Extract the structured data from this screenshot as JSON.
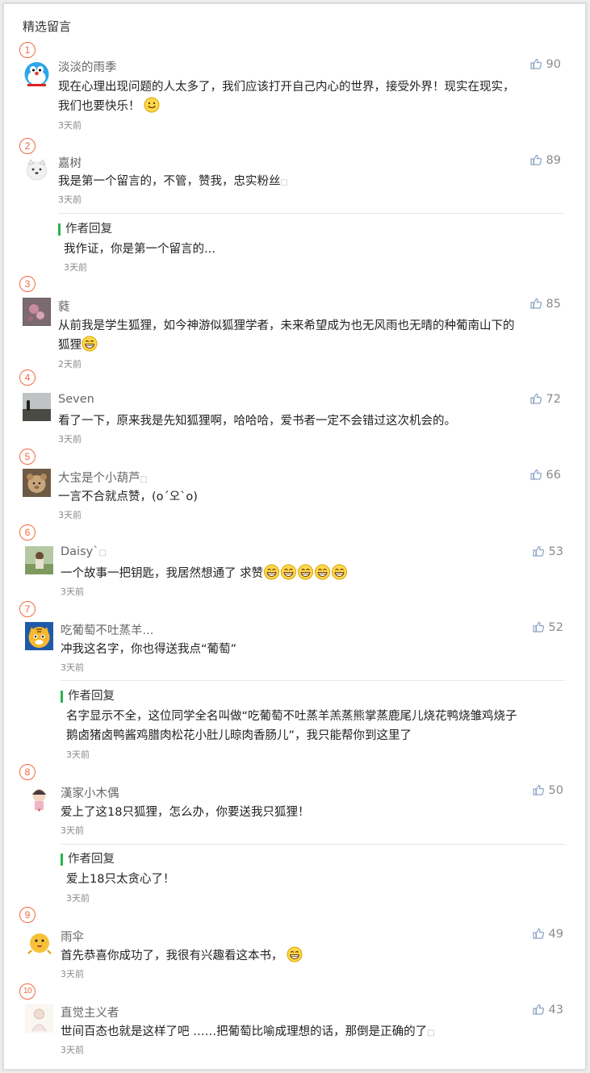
{
  "section_title": "精选留言",
  "reply_label": "作者回复",
  "comments": [
    {
      "num": "1",
      "nick": "淡淡的雨季",
      "likes": "90",
      "line1": "现在心理出现问题的人太多了，我们应该打开自己内心的世界，接受外界！现实在现实，",
      "line2": "我们也要快乐！",
      "time": "3天前",
      "avatar": "doraemon"
    },
    {
      "num": "2",
      "nick": "嘉树",
      "likes": "89",
      "line1": "我是第一个留言的，不管，赞我，忠实粉丝",
      "line2": "",
      "time": "3天前",
      "avatar": "white-dog",
      "reply": {
        "text": "我作证，你是第一个留言的...",
        "time": "3天前"
      }
    },
    {
      "num": "3",
      "nick": "蕤",
      "likes": "85",
      "line1": "从前我是学生狐狸，如今神游似狐狸学者，未来希望成为也无风雨也无晴的种葡南山下的",
      "line2": "狐狸",
      "time": "2天前",
      "avatar": "flower"
    },
    {
      "num": "4",
      "nick": "Seven",
      "likes": "72",
      "line1": "看了一下，原来我是先知狐狸啊，哈哈哈，爱书者一定不会错过这次机会的。",
      "line2": "",
      "time": "3天前",
      "avatar": "landscape"
    },
    {
      "num": "5",
      "nick": "大宝是个小葫芦",
      "likes": "66",
      "line1": "一言不合就点赞，(o´오`o)",
      "line2": "",
      "time": "3天前",
      "avatar": "bear"
    },
    {
      "num": "6",
      "nick": "Daisy`",
      "likes": "53",
      "line1": "一个故事一把钥匙，我居然想通了 求赞",
      "line2": "",
      "time": "3天前",
      "avatar": "girl"
    },
    {
      "num": "7",
      "nick": "吃葡萄不吐蒸羊...",
      "likes": "52",
      "line1": "冲我这名字，你也得送我点“葡萄”",
      "line2": "",
      "time": "3天前",
      "avatar": "tiger",
      "reply": {
        "text": "名字显示不全，这位同学全名叫做“吃葡萄不吐蒸羊羔蒸熊掌蒸鹿尾儿烧花鸭烧雏鸡烧子",
        "text2": "鹅卤猪卤鸭酱鸡腊肉松花小肚儿晾肉香肠儿”，我只能帮你到这里了",
        "time": "3天前"
      }
    },
    {
      "num": "8",
      "nick": "漢家小木偶",
      "likes": "50",
      "line1": "爱上了这18只狐狸，怎么办，你要送我只狐狸！",
      "line2": "",
      "time": "3天前",
      "avatar": "doll",
      "reply": {
        "text": "爱上18只太贪心了！",
        "time": "3天前"
      }
    },
    {
      "num": "9",
      "nick": "雨伞",
      "likes": "49",
      "line1": "首先恭喜你成功了，我很有兴趣看这本书，",
      "line2": "",
      "time": "3天前",
      "avatar": "chick"
    },
    {
      "num": "10",
      "nick": "直觉主义者",
      "likes": "43",
      "line1": "世间百态也就是这样了吧 ……把葡萄比喻成理想的话，那倒是正确的了",
      "line2": "",
      "time": "3天前",
      "avatar": "sketch"
    }
  ]
}
